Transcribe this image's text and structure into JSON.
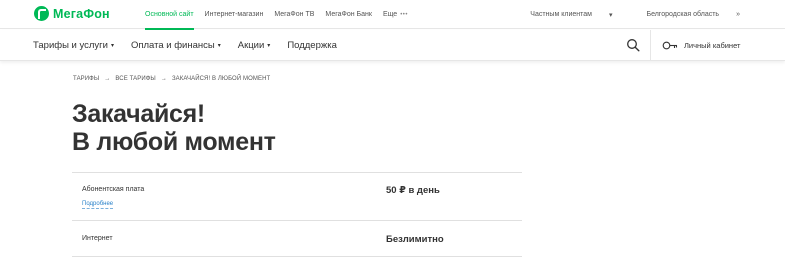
{
  "brand": {
    "name": "МегаФон",
    "color": "#00b956"
  },
  "top_nav": {
    "items": [
      {
        "label": "Основной сайт",
        "active": true
      },
      {
        "label": "Интернет-магазин"
      },
      {
        "label": "МегаФон ТВ"
      },
      {
        "label": "МегаФон Банк"
      },
      {
        "label": "Еще"
      }
    ],
    "more_dots": "•••",
    "clients": "Частным клиентам",
    "region": "Белгородская область"
  },
  "main_nav": {
    "items": [
      {
        "label": "Тарифы и услуги",
        "has_dropdown": true
      },
      {
        "label": "Оплата и финансы",
        "has_dropdown": true
      },
      {
        "label": "Акции",
        "has_dropdown": true
      },
      {
        "label": "Поддержка",
        "has_dropdown": false
      }
    ],
    "search_icon": "search-icon",
    "cabinet_label": "Личный кабинет",
    "cabinet_icon": "key-icon"
  },
  "breadcrumbs": [
    "Тарифы",
    "Все тарифы",
    "Закачайся! В любой момент"
  ],
  "breadcrumb_separator": "→",
  "page_title": {
    "line1": "Закачайся!",
    "line2": "В любой момент"
  },
  "tariff_rows": [
    {
      "label": "Абонентская плата",
      "link": "Подробнее",
      "value": "50 ₽ в день"
    },
    {
      "label": "Интернет",
      "value": "Безлимитно"
    }
  ]
}
